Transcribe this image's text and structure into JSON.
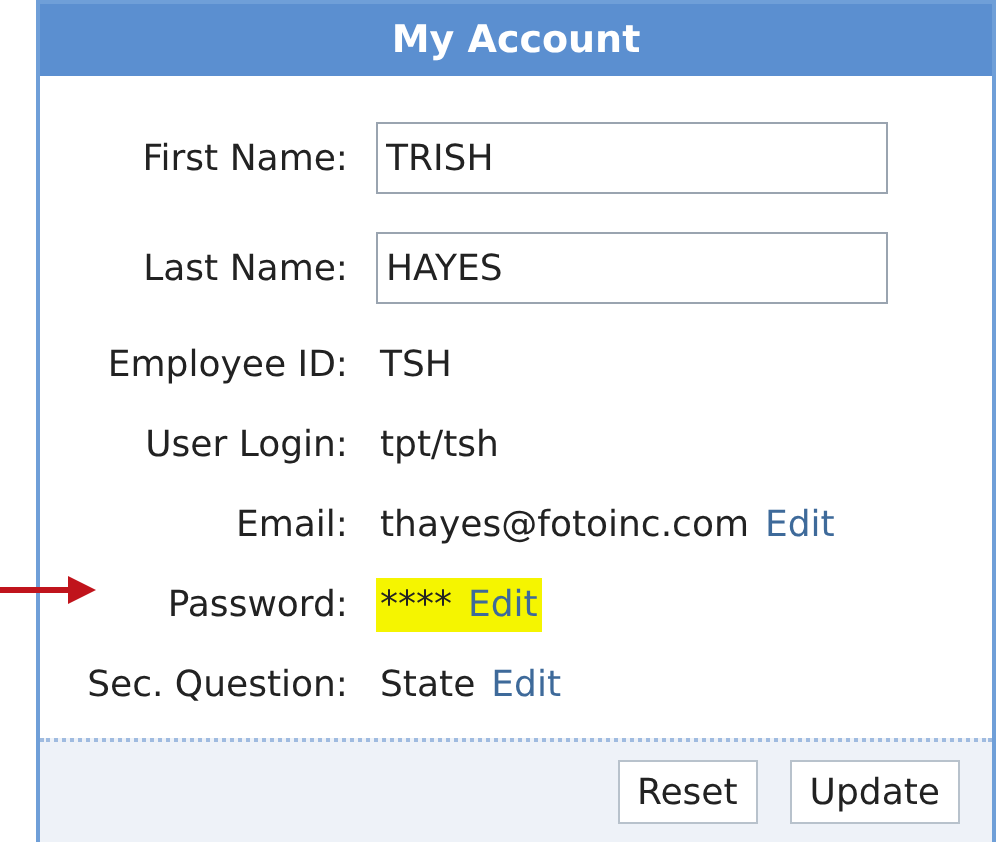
{
  "panel": {
    "title": "My Account"
  },
  "fields": [
    {
      "kind": "input",
      "label": "First Name:",
      "value": "TRISH"
    },
    {
      "kind": "input",
      "label": "Last Name:",
      "value": "HAYES"
    },
    {
      "kind": "text",
      "label": "Employee ID:",
      "value": "TSH"
    },
    {
      "kind": "text",
      "label": "User Login:",
      "value": "tpt/tsh"
    },
    {
      "kind": "text",
      "label": "Email:",
      "value": "thayes@fotoinc.com",
      "link": "Edit",
      "highlighted": false
    },
    {
      "kind": "text",
      "label": "Password:",
      "value": "****",
      "link": "Edit",
      "highlighted": true
    },
    {
      "kind": "text",
      "label": "Sec. Question:",
      "value": "State",
      "link": "Edit",
      "highlighted": false
    }
  ],
  "buttons": [
    "Reset",
    "Update"
  ]
}
